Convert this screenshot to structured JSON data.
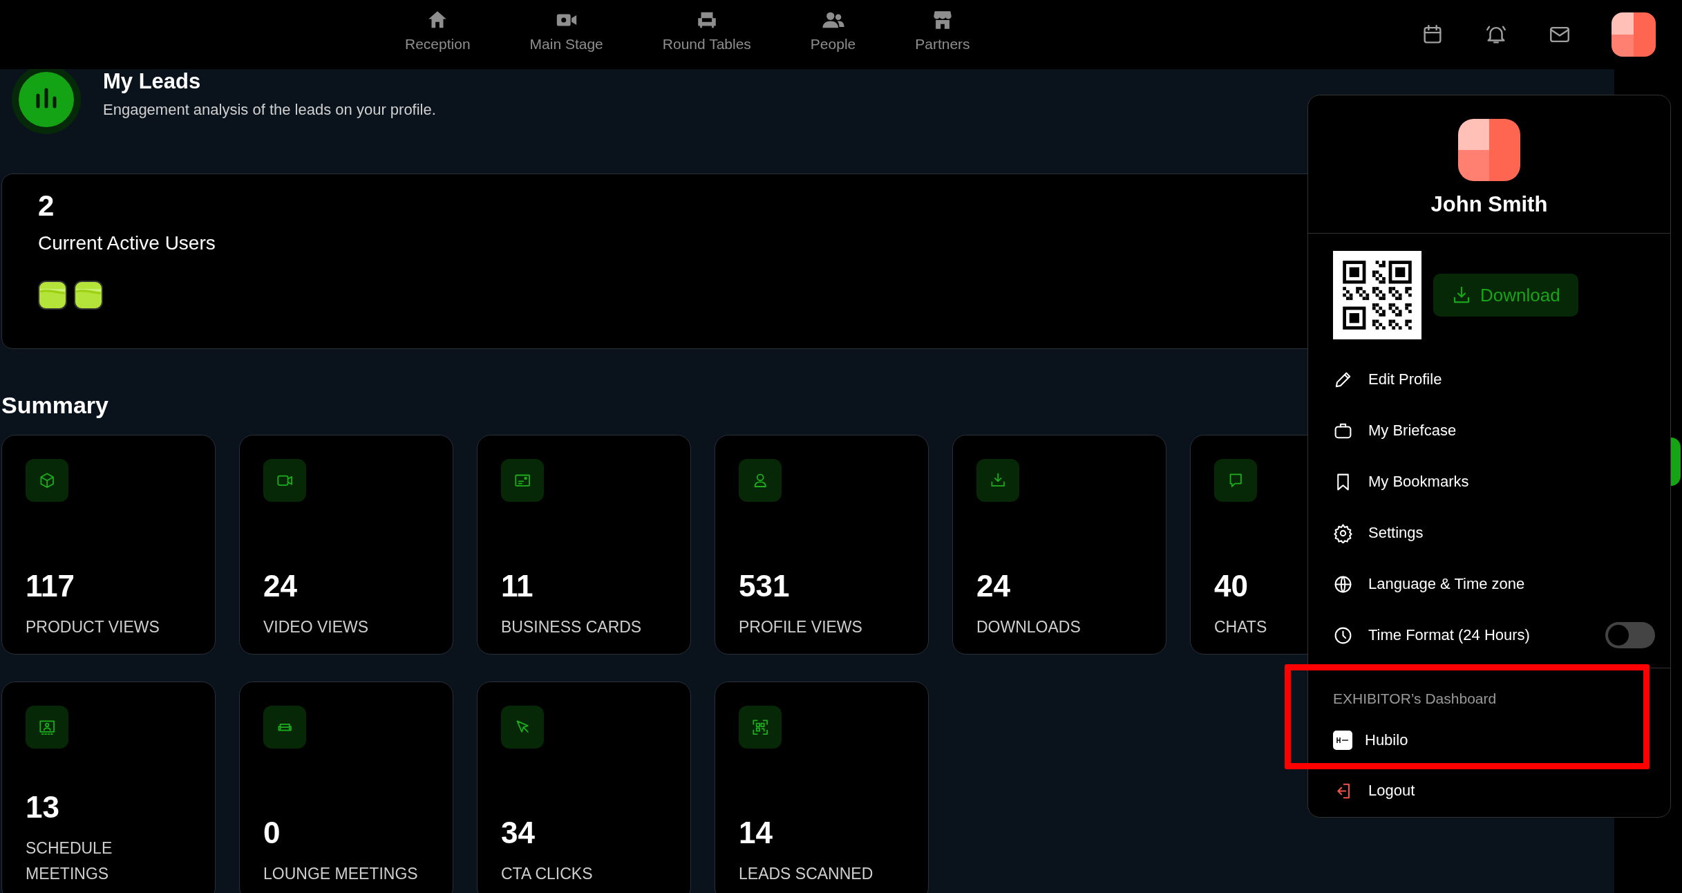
{
  "nav": {
    "items": [
      {
        "label": "Reception"
      },
      {
        "label": "Main Stage"
      },
      {
        "label": "Round Tables"
      },
      {
        "label": "People"
      },
      {
        "label": "Partners"
      }
    ]
  },
  "header": {
    "title": "My Leads",
    "subtitle": "Engagement analysis of the leads on your profile."
  },
  "active_users": {
    "count": "2",
    "label": "Current Active Users",
    "avatars": [
      {
        "kind": "avatar"
      },
      {
        "kind": "avatar"
      }
    ]
  },
  "summary": {
    "title": "Summary",
    "cards": [
      {
        "value": "117",
        "label": "PRODUCT VIEWS"
      },
      {
        "value": "24",
        "label": "VIDEO VIEWS"
      },
      {
        "value": "11",
        "label": "BUSINESS CARDS"
      },
      {
        "value": "531",
        "label": "PROFILE VIEWS"
      },
      {
        "value": "24",
        "label": "DOWNLOADS"
      },
      {
        "value": "40",
        "label": "CHATS"
      },
      {
        "value": "13",
        "label": "SCHEDULE MEETINGS"
      },
      {
        "value": "0",
        "label": "LOUNGE MEETINGS"
      },
      {
        "value": "34",
        "label": "CTA CLICKS"
      },
      {
        "value": "14",
        "label": "LEADS SCANNED"
      }
    ]
  },
  "profile_menu": {
    "name": "John Smith",
    "download": "Download",
    "items": [
      {
        "kind": "link",
        "label": "Edit Profile"
      },
      {
        "kind": "link",
        "label": "My Briefcase"
      },
      {
        "kind": "link",
        "label": "My Bookmarks"
      },
      {
        "kind": "link",
        "label": "Settings"
      },
      {
        "kind": "link",
        "label": "Language & Time zone"
      },
      {
        "kind": "toggle",
        "label": "Time Format (24 Hours)",
        "on": false
      }
    ],
    "section_title": "EXHIBITOR’s Dashboard",
    "dashboards": [
      {
        "label": "Hubilo"
      }
    ],
    "logout": "Logout"
  }
}
